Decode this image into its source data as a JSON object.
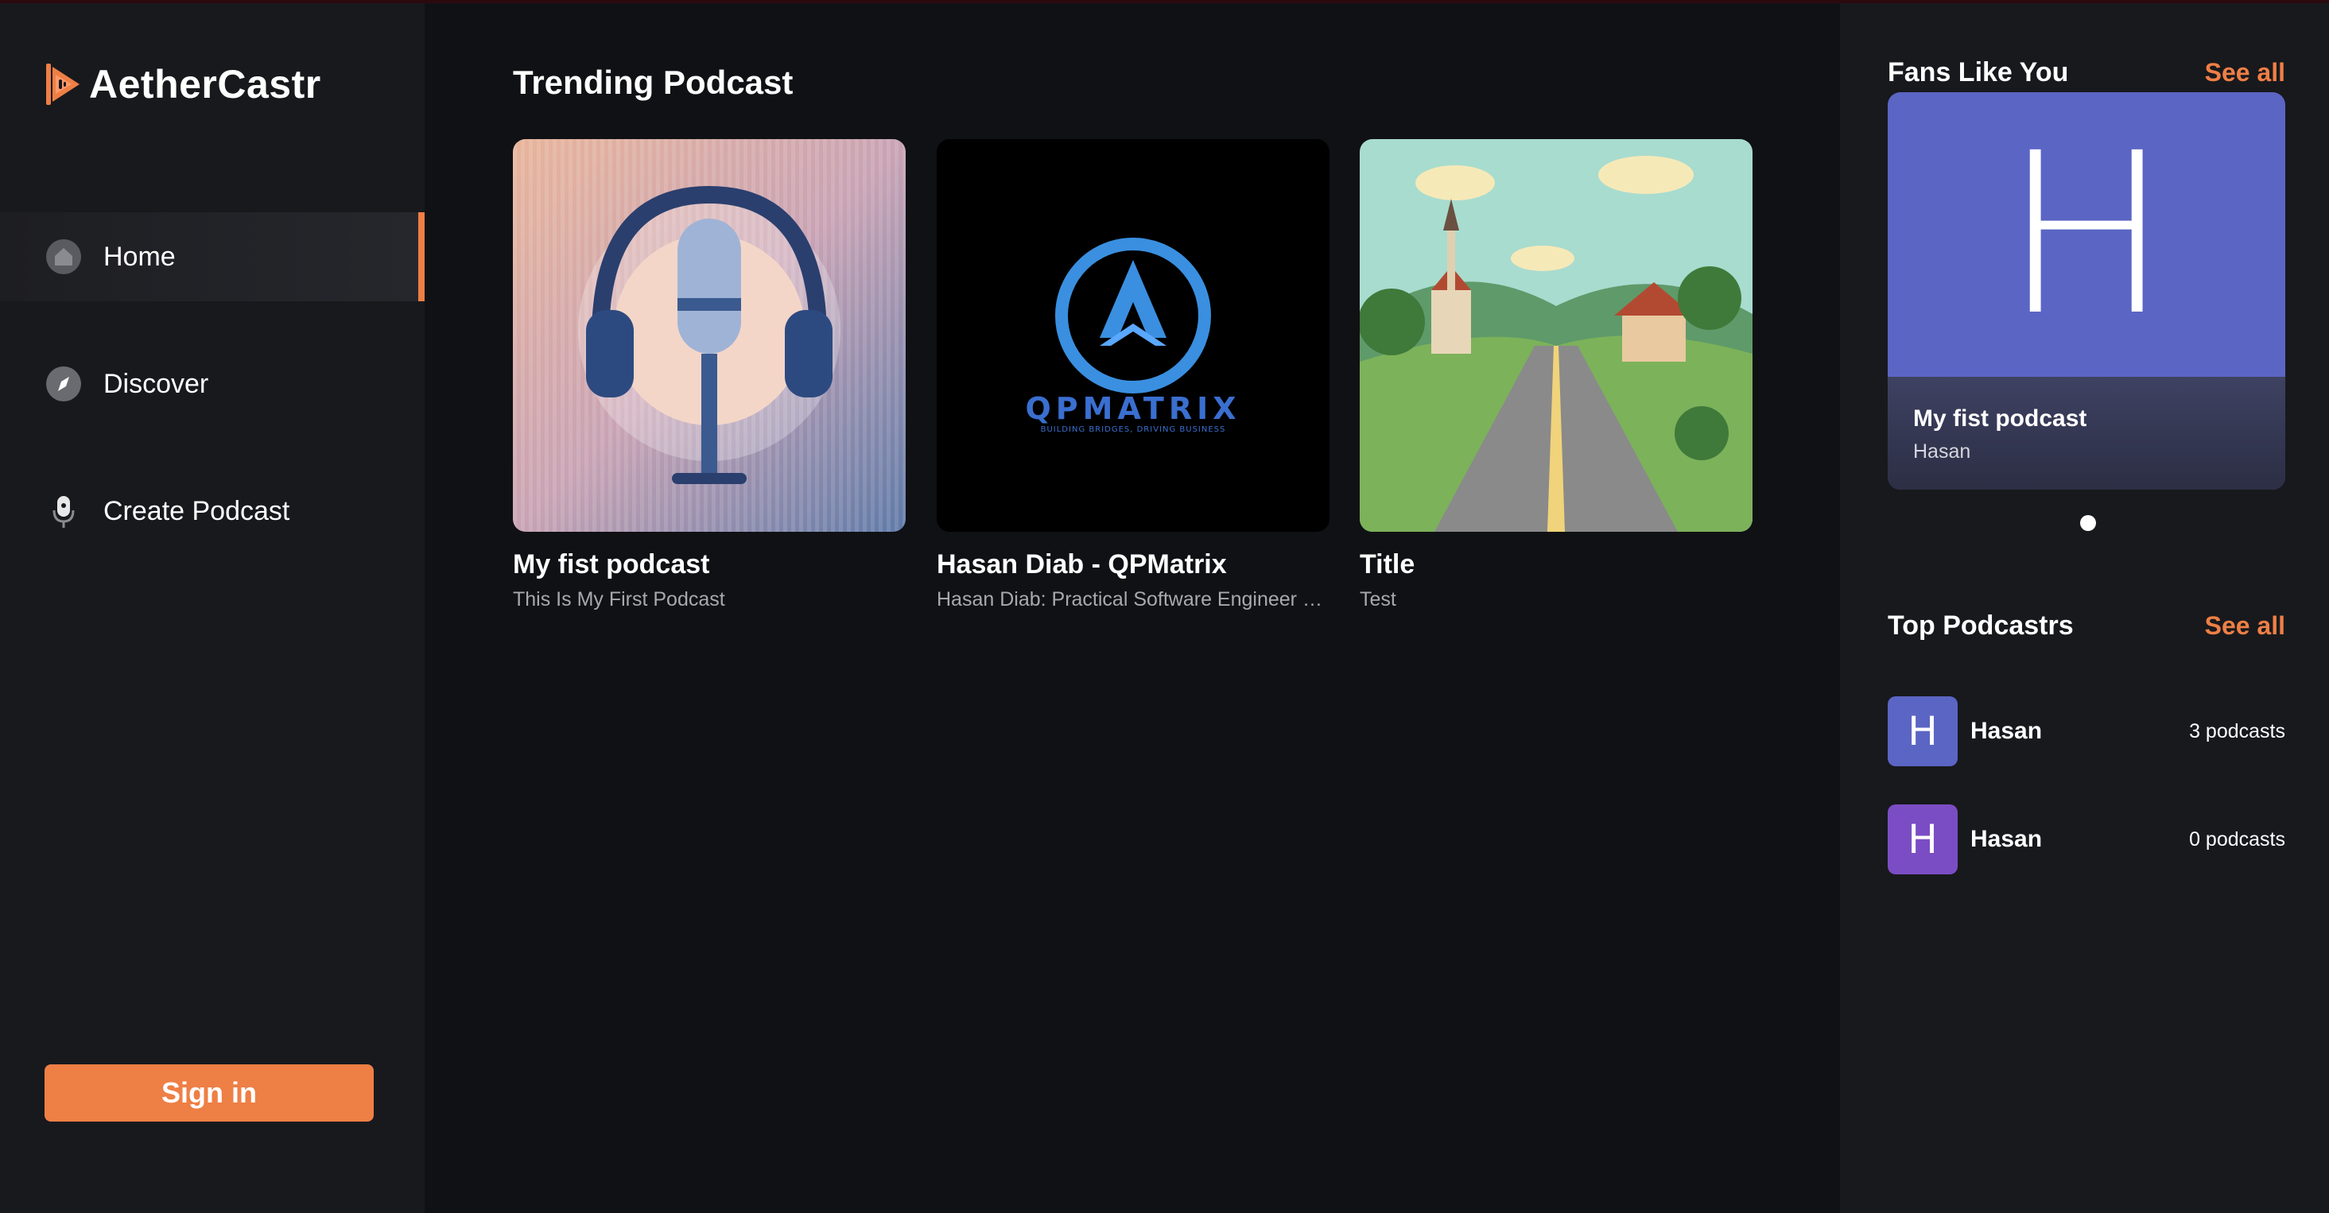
{
  "app": {
    "name": "AetherCastr"
  },
  "sidebar": {
    "items": [
      {
        "label": "Home",
        "icon": "home-icon",
        "active": true
      },
      {
        "label": "Discover",
        "icon": "compass-icon",
        "active": false
      },
      {
        "label": "Create Podcast",
        "icon": "microphone-icon",
        "active": false
      }
    ],
    "signin_label": "Sign in"
  },
  "main": {
    "title": "Trending Podcast",
    "podcasts": [
      {
        "title": "My fist podcast",
        "description": "This Is My First Podcast",
        "image": "headphones-microphone-artwork"
      },
      {
        "title": "Hasan Diab - QPMatrix",
        "description": "Hasan Diab: Practical Software Engineer & I...",
        "image": "qpmatrix-logo",
        "logo_text": "QPMATRIX",
        "logo_tagline": "BUILDING BRIDGES, DRIVING BUSINESS"
      },
      {
        "title": "Title",
        "description": "Test",
        "image": "village-road-landscape"
      }
    ]
  },
  "right": {
    "fans": {
      "title": "Fans Like You",
      "see_all": "See all",
      "card": {
        "letter": "H",
        "title": "My fist podcast",
        "author": "Hasan"
      }
    },
    "top": {
      "title": "Top Podcastrs",
      "see_all": "See all",
      "items": [
        {
          "initial": "H",
          "name": "Hasan",
          "count": "3 podcasts",
          "color": "#5b65c4"
        },
        {
          "initial": "H",
          "name": "Hasan",
          "count": "0 podcasts",
          "color": "#7b4dc4"
        }
      ]
    }
  },
  "colors": {
    "accent": "#ee7f45",
    "background": "#101114",
    "panel": "#18191d"
  }
}
